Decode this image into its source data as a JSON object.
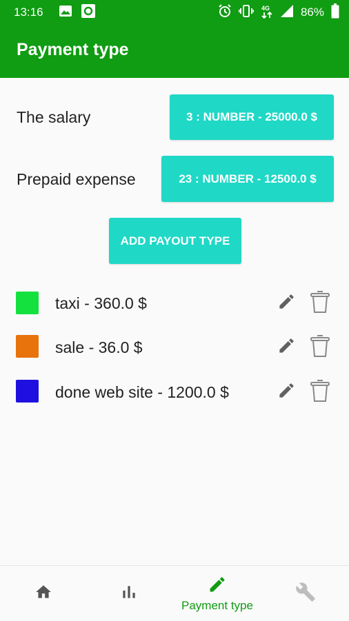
{
  "status_bar": {
    "time": "13:16",
    "battery": "86%",
    "icons": [
      "image-icon",
      "record-icon",
      "alarm-icon",
      "vibrate-icon",
      "4g-icon",
      "signal-icon",
      "battery-icon"
    ]
  },
  "app_bar": {
    "title": "Payment type"
  },
  "payout_rows": [
    {
      "label": "The salary",
      "button": "3 : NUMBER - 25000.0  $"
    },
    {
      "label": "Prepaid expense",
      "button": "23 : NUMBER - 12500.0  $"
    }
  ],
  "add_button_label": "ADD PAYOUT TYPE",
  "items": [
    {
      "text": "taxi - 360.0 $",
      "color": "#14e13d"
    },
    {
      "text": "sale - 36.0 $",
      "color": "#e8720c"
    },
    {
      "text": "done web site - 1200.0 $",
      "color": "#1f10e0"
    }
  ],
  "bottom_nav": {
    "active_label": "Payment type",
    "items": [
      "home-icon",
      "bar-chart-icon",
      "pencil-icon",
      "wrench-icon"
    ],
    "active_color": "#109c13"
  }
}
